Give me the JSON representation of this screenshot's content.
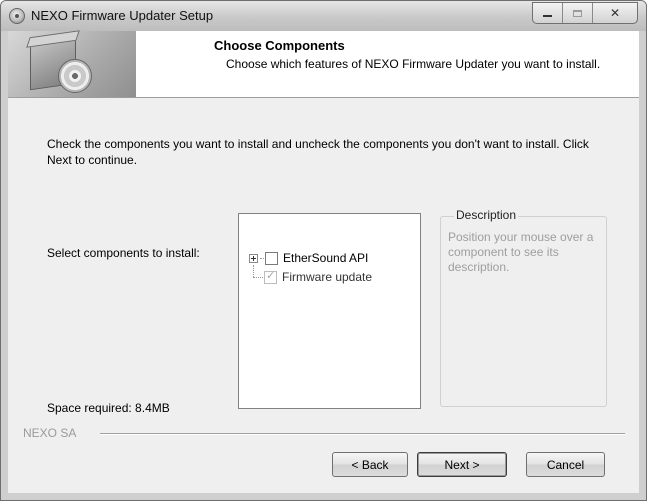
{
  "window": {
    "title": "NEXO Firmware Updater Setup"
  },
  "header": {
    "title": "Choose Components",
    "subtitle": "Choose which features of NEXO Firmware Updater you want to install."
  },
  "body": {
    "intro": "Check the components you want to install and uncheck the components you don't want to install. Click Next to continue.",
    "select_label": "Select components to install:",
    "space_required": "Space required: 8.4MB"
  },
  "components": [
    {
      "label": "EtherSound API",
      "checked": false,
      "expandable": true
    },
    {
      "label": "Firmware update",
      "checked": true,
      "disabled": true
    }
  ],
  "description": {
    "title": "Description",
    "text": "Position your mouse over a component to see its description."
  },
  "footer": {
    "brand": "NEXO SA",
    "back_label": "< Back",
    "next_label": "Next >",
    "cancel_label": "Cancel"
  }
}
